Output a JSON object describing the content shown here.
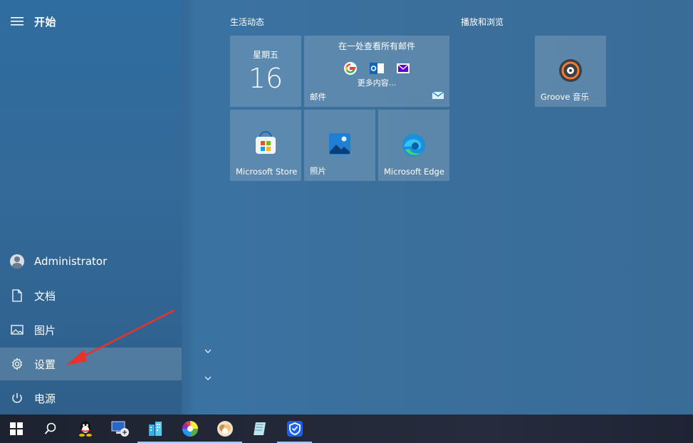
{
  "start_menu": {
    "title": "开始",
    "rail_items": [
      {
        "label": "Administrator",
        "icon": "user-avatar-icon"
      },
      {
        "label": "文档",
        "icon": "document-icon"
      },
      {
        "label": "图片",
        "icon": "pictures-icon"
      },
      {
        "label": "设置",
        "icon": "gear-icon"
      },
      {
        "label": "电源",
        "icon": "power-icon"
      }
    ]
  },
  "groups": [
    {
      "title": "生活动态"
    },
    {
      "title": "播放和浏览"
    }
  ],
  "tiles": {
    "calendar": {
      "weekday": "星期五",
      "day": "16"
    },
    "mail": {
      "header": "在一处查看所有邮件",
      "more": "更多内容...",
      "label": "邮件"
    },
    "store": {
      "label": "Microsoft Store"
    },
    "photos": {
      "label": "照片"
    },
    "edge": {
      "label": "Microsoft Edge"
    },
    "groove": {
      "label": "Groove 音乐"
    }
  },
  "taskbar": {
    "items": [
      "windows-start-icon",
      "search-icon",
      "qq-icon",
      "remote-desktop-icon",
      "buildings-app-icon",
      "color-wheel-app-icon",
      "baidu-netdisk-icon",
      "notepad-app-icon",
      "shield-security-icon"
    ]
  },
  "colors": {
    "accent": "#2d6597",
    "annotation_arrow": "#e8322c",
    "taskbar": "#232838"
  }
}
